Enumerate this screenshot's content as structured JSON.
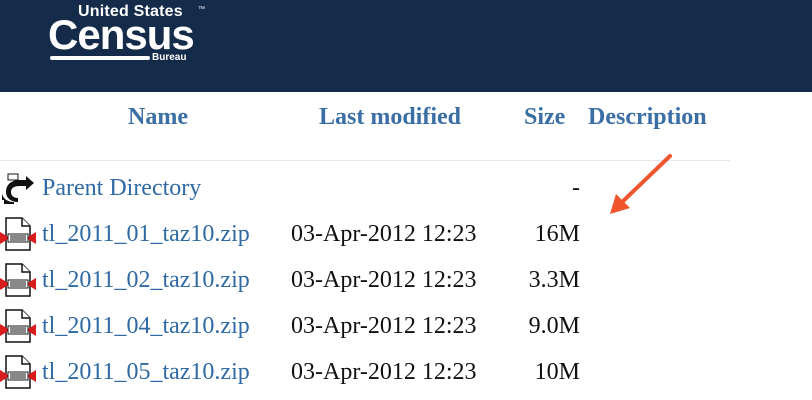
{
  "header": {
    "logo": {
      "top": "United States",
      "tm": "™",
      "main": "Census",
      "sub": "Bureau"
    },
    "background_color": "#142b4a"
  },
  "table": {
    "columns": {
      "name": "Name",
      "last_modified": "Last modified",
      "size": "Size",
      "description": "Description"
    },
    "rows": [
      {
        "icon": "back-icon",
        "name": "Parent Directory",
        "modified": "",
        "size": "-"
      },
      {
        "icon": "compressed-file-icon",
        "name": "tl_2011_01_taz10.zip",
        "modified": "03-Apr-2012 12:23",
        "size": "16M"
      },
      {
        "icon": "compressed-file-icon",
        "name": "tl_2011_02_taz10.zip",
        "modified": "03-Apr-2012 12:23",
        "size": "3.3M"
      },
      {
        "icon": "compressed-file-icon",
        "name": "tl_2011_04_taz10.zip",
        "modified": "03-Apr-2012 12:23",
        "size": "9.0M"
      },
      {
        "icon": "compressed-file-icon",
        "name": "tl_2011_05_taz10.zip",
        "modified": "03-Apr-2012 12:23",
        "size": "10M"
      }
    ]
  },
  "colors": {
    "link": "#2f6aa5",
    "header_text": "#3a6ea5",
    "annotation_arrow": "#f0552e"
  }
}
